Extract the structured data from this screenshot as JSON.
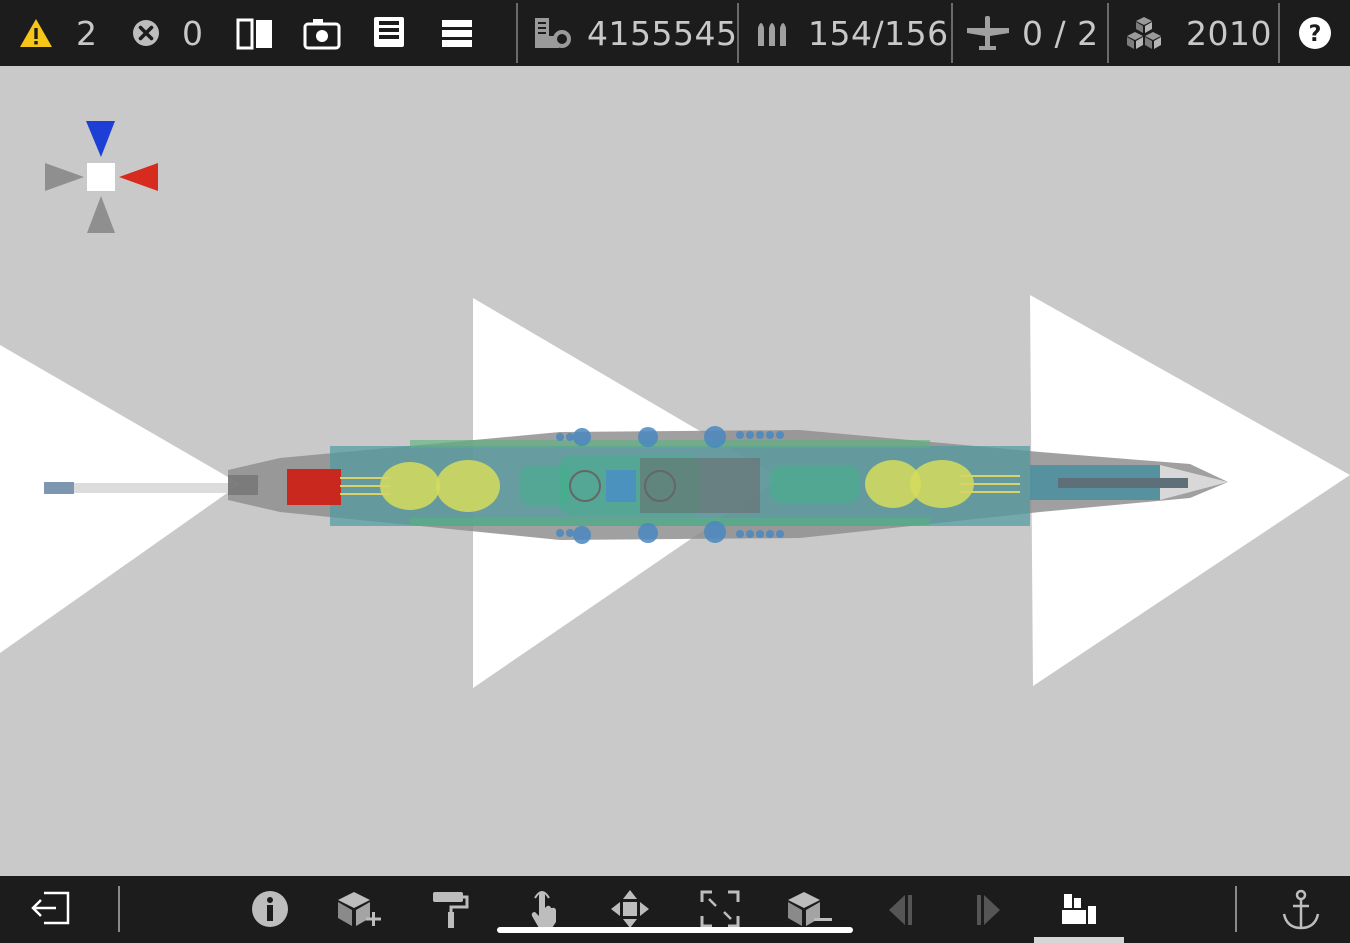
{
  "topbar": {
    "warnings_count": "2",
    "errors_count": "0",
    "cost_value": "4155545",
    "armament_value": "154/156",
    "aircraft_value": "0 / 2",
    "year_value": "2010",
    "colors": {
      "background": "#1c1c1c",
      "text": "#c8c8c8",
      "warning": "#f5c518"
    }
  },
  "compass": {
    "colors": {
      "up": "#1e3fd6",
      "right": "#d62b1e",
      "left_down": "#8f8f8f",
      "center": "#ffffff"
    }
  },
  "bottombar": {
    "icons": [
      "exit-icon",
      "info-icon",
      "add-block-icon",
      "paint-roller-icon",
      "touch-icon",
      "move-icon",
      "resize-icon",
      "remove-block-icon",
      "prev-icon",
      "next-icon",
      "factory-icon",
      "anchor-icon"
    ]
  },
  "canvas": {
    "background": "#c9c9c9"
  }
}
